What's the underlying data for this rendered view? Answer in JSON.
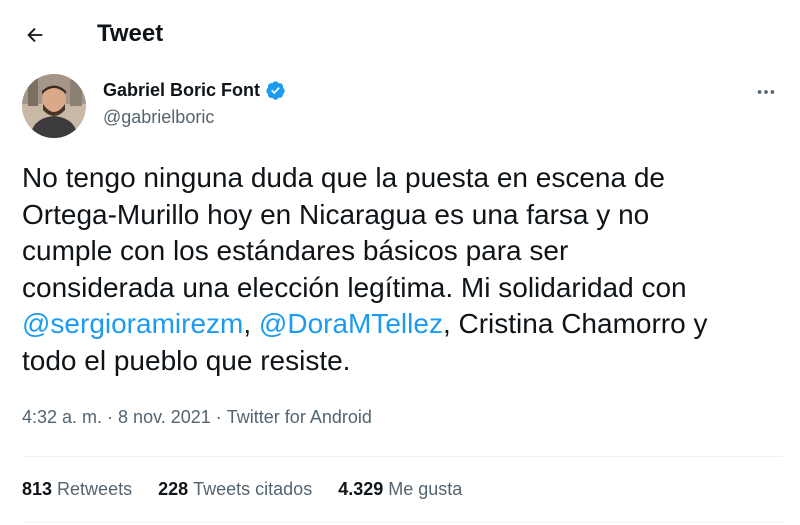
{
  "header": {
    "title": "Tweet",
    "back_icon": "arrow-left-icon"
  },
  "author": {
    "display_name": "Gabriel Boric Font",
    "handle": "@gabrielboric",
    "verified": true,
    "verified_color": "#1d9bf0"
  },
  "tweet": {
    "segments": [
      {
        "text": "No tengo ninguna duda que la puesta en escena de\nOrtega-Murillo hoy en Nicaragua es una farsa y no\ncumple con los estándares básicos para ser\nconsiderada una elección legítima. Mi solidaridad con\n",
        "type": "text"
      },
      {
        "text": "@sergioramirezm",
        "type": "mention"
      },
      {
        "text": ", ",
        "type": "text"
      },
      {
        "text": "@DoraMTellez",
        "type": "mention"
      },
      {
        "text": ", Cristina Chamorro y\ntodo el pueblo que resiste.",
        "type": "text"
      }
    ],
    "time": "4:32 a. m.",
    "date": "8 nov. 2021",
    "separator": "·",
    "source": "Twitter for Android"
  },
  "stats": {
    "retweets": {
      "count": "813",
      "label": "Retweets"
    },
    "quotes": {
      "count": "228",
      "label": "Tweets citados"
    },
    "likes": {
      "count": "4.329",
      "label": "Me gusta"
    }
  },
  "colors": {
    "text": "#0f1419",
    "secondary": "#536471",
    "accent": "#1d9bf0",
    "divider": "#eff3f4"
  }
}
